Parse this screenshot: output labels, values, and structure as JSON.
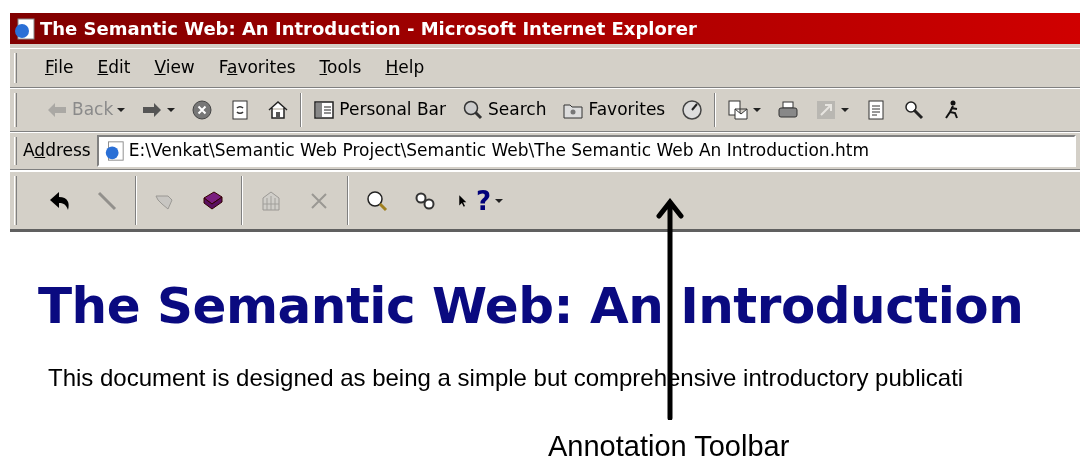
{
  "window": {
    "title": "The Semantic Web: An Introduction - Microsoft Internet Explorer"
  },
  "menu": [
    {
      "key": "F",
      "post": "ile"
    },
    {
      "key": "E",
      "post": "dit"
    },
    {
      "key": "V",
      "post": "iew"
    },
    {
      "pre": "F",
      "key": "a",
      "post": "vorites"
    },
    {
      "key": "T",
      "post": "ools"
    },
    {
      "key": "H",
      "post": "elp"
    }
  ],
  "toolbar": [
    {
      "kind": "button",
      "label": "Back",
      "disabled": true,
      "dropdown": true
    },
    {
      "kind": "button",
      "disabled": false,
      "dropdown": true
    },
    {
      "kind": "button",
      "disabled": false,
      "dropdown": false
    },
    {
      "kind": "button",
      "disabled": false,
      "dropdown": false
    },
    {
      "kind": "button",
      "disabled": false,
      "dropdown": false
    },
    {
      "kind": "separator"
    },
    {
      "kind": "button",
      "label": "Personal Bar",
      "disabled": false,
      "dropdown": false
    },
    {
      "kind": "button",
      "label": "Search",
      "disabled": false,
      "dropdown": false
    },
    {
      "kind": "button",
      "label": "Favorites",
      "disabled": false,
      "dropdown": false
    },
    {
      "kind": "button",
      "disabled": false,
      "dropdown": false
    },
    {
      "kind": "separator"
    },
    {
      "kind": "button",
      "disabled": false,
      "dropdown": true
    },
    {
      "kind": "button",
      "disabled": false,
      "dropdown": false
    },
    {
      "kind": "button",
      "disabled": true,
      "dropdown": true
    },
    {
      "kind": "button",
      "disabled": false,
      "dropdown": false
    },
    {
      "kind": "button",
      "disabled": false,
      "dropdown": false
    },
    {
      "kind": "button",
      "disabled": false,
      "dropdown": false
    }
  ],
  "address": {
    "pre": "A",
    "key": "d",
    "post": "dress",
    "value": "E:\\Venkat\\Semantic Web Project\\Semantic Web\\The Semantic Web An Introduction.htm"
  },
  "annotation_toolbar": [
    {
      "kind": "button",
      "disabled": false,
      "dropdown": false
    },
    {
      "kind": "button",
      "disabled": true,
      "dropdown": false
    },
    {
      "kind": "separator"
    },
    {
      "kind": "button",
      "disabled": true,
      "dropdown": false
    },
    {
      "kind": "button",
      "disabled": false,
      "dropdown": false
    },
    {
      "kind": "separator"
    },
    {
      "kind": "button",
      "disabled": true,
      "dropdown": false
    },
    {
      "kind": "button",
      "disabled": true,
      "dropdown": false
    },
    {
      "kind": "separator"
    },
    {
      "kind": "button",
      "disabled": false,
      "dropdown": false
    },
    {
      "kind": "button",
      "disabled": false,
      "dropdown": false
    },
    {
      "kind": "button",
      "glyph": "?",
      "disabled": false,
      "dropdown": true
    }
  ],
  "page": {
    "heading": "The Semantic Web: An Introduction",
    "paragraph": "This document is designed as being a simple but comprehensive introductory publicati"
  },
  "callout": {
    "label": "Annotation Toolbar"
  }
}
